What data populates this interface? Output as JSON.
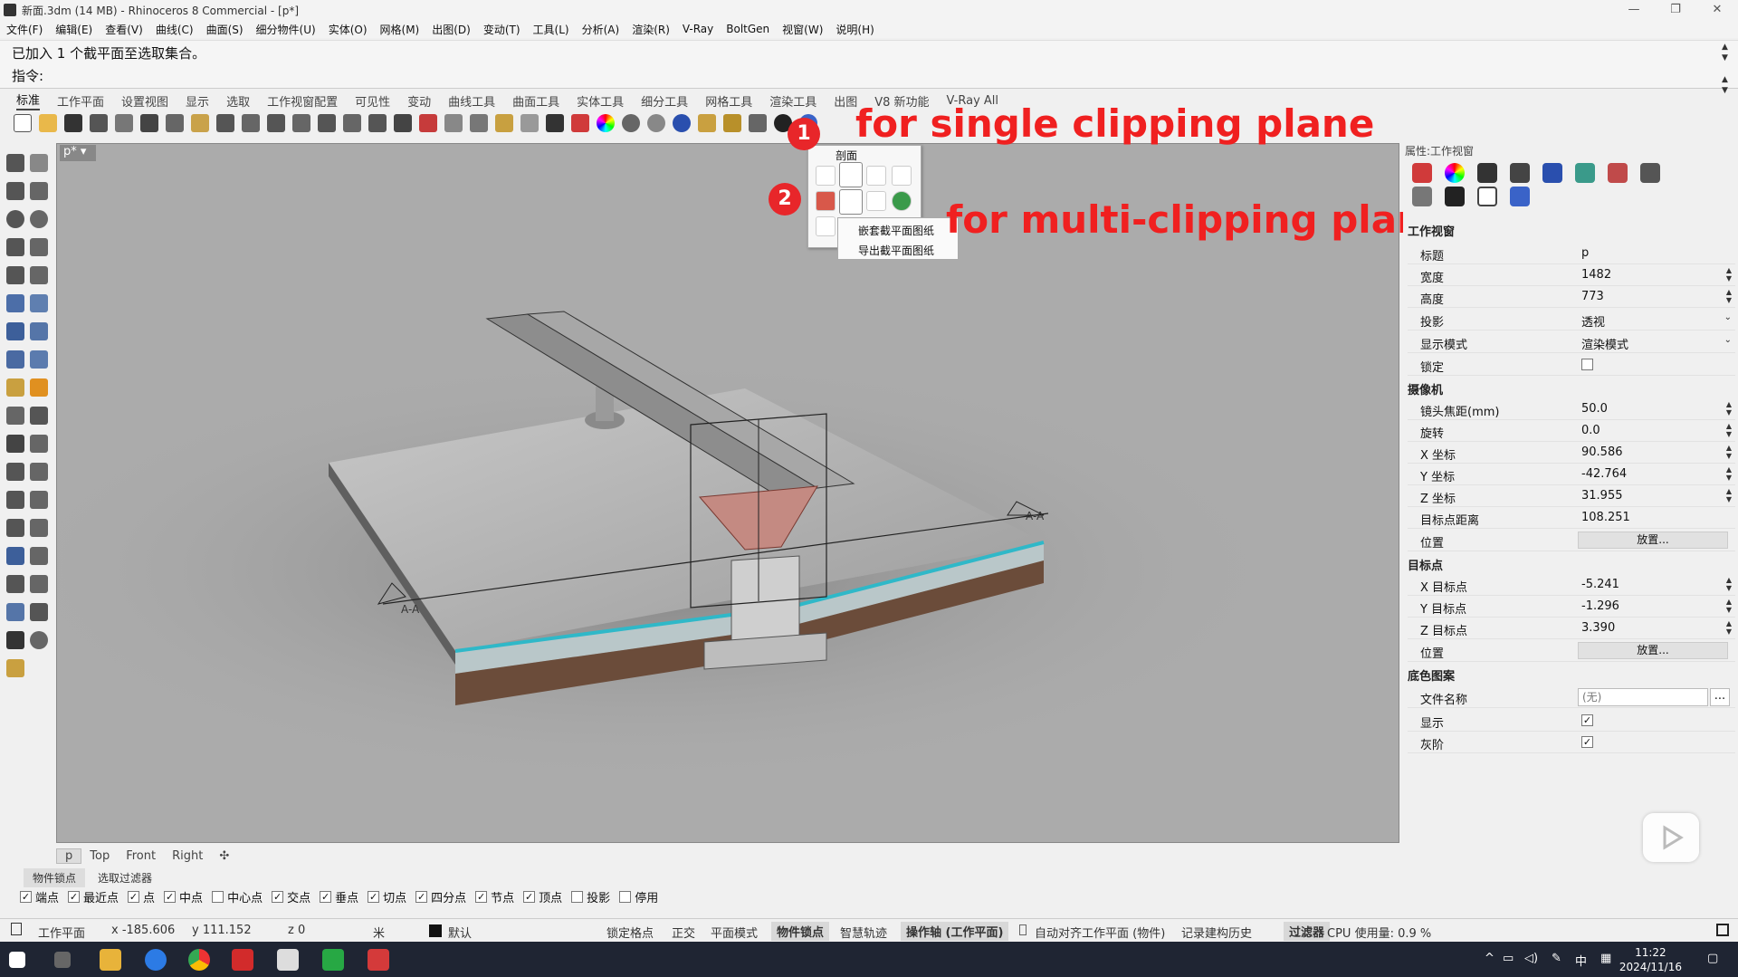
{
  "window": {
    "title": "新面.3dm (14 MB) - Rhinoceros 8 Commercial - [p*]",
    "controls": [
      "—",
      "❐",
      "✕"
    ]
  },
  "menu": [
    "文件(F)",
    "编辑(E)",
    "查看(V)",
    "曲线(C)",
    "曲面(S)",
    "细分物件(U)",
    "实体(O)",
    "网格(M)",
    "出图(D)",
    "变动(T)",
    "工具(L)",
    "分析(A)",
    "渲染(R)",
    "V-Ray",
    "BoltGen",
    "视窗(W)",
    "说明(H)"
  ],
  "command": {
    "history": "已加入 1 个截平面至选取集合。",
    "prompt": "指令:"
  },
  "toolbar_tabs": [
    "标准",
    "工作平面",
    "设置视图",
    "显示",
    "选取",
    "工作视窗配置",
    "可见性",
    "变动",
    "曲线工具",
    "曲面工具",
    "实体工具",
    "细分工具",
    "网格工具",
    "渲染工具",
    "出图",
    "V8 新功能",
    "V-Ray All"
  ],
  "viewport": {
    "tab_label": "p*",
    "section_label": "A-A"
  },
  "popup": {
    "title": "剖面",
    "submenu": [
      "嵌套截平面图纸",
      "导出截平面图纸"
    ]
  },
  "annotations": {
    "badge1": "1",
    "badge2": "2",
    "text1": "for single clipping plane",
    "text2": "for multi-clipping planes"
  },
  "properties": {
    "title": "属性:工作视窗",
    "viewport_section": "工作视窗",
    "rows_viewport": [
      {
        "label": "标题",
        "value": "p"
      },
      {
        "label": "宽度",
        "value": "1482"
      },
      {
        "label": "高度",
        "value": "773"
      },
      {
        "label": "投影",
        "value": "透视"
      },
      {
        "label": "显示模式",
        "value": "渲染模式"
      },
      {
        "label": "锁定",
        "value": ""
      }
    ],
    "camera_section": "摄像机",
    "rows_camera": [
      {
        "label": "镜头焦距(mm)",
        "value": "50.0"
      },
      {
        "label": "旋转",
        "value": "0.0"
      },
      {
        "label": "X 坐标",
        "value": "90.586"
      },
      {
        "label": "Y 坐标",
        "value": "-42.764"
      },
      {
        "label": "Z 坐标",
        "value": "31.955"
      },
      {
        "label": "目标点距离",
        "value": "108.251"
      },
      {
        "label": "位置",
        "value": "放置..."
      }
    ],
    "target_section": "目标点",
    "rows_target": [
      {
        "label": "X 目标点",
        "value": "-5.241"
      },
      {
        "label": "Y 目标点",
        "value": "-1.296"
      },
      {
        "label": "Z 目标点",
        "value": "3.390"
      },
      {
        "label": "位置",
        "value": "放置..."
      }
    ],
    "bg_section": "底色图案",
    "rows_bg": [
      {
        "label": "文件名称",
        "value": "(无)"
      },
      {
        "label": "显示",
        "value": "✓"
      },
      {
        "label": "灰阶",
        "value": "✓"
      }
    ]
  },
  "view_tabs": [
    "p",
    "Top",
    "Front",
    "Right",
    "✣"
  ],
  "osnap_tabs": [
    "物件锁点",
    "选取过滤器"
  ],
  "osnaps": [
    {
      "label": "端点",
      "checked": true
    },
    {
      "label": "最近点",
      "checked": true
    },
    {
      "label": "点",
      "checked": true
    },
    {
      "label": "中点",
      "checked": true
    },
    {
      "label": "中心点",
      "checked": false
    },
    {
      "label": "交点",
      "checked": true
    },
    {
      "label": "垂点",
      "checked": true
    },
    {
      "label": "切点",
      "checked": true
    },
    {
      "label": "四分点",
      "checked": true
    },
    {
      "label": "节点",
      "checked": true
    },
    {
      "label": "顶点",
      "checked": true
    },
    {
      "label": "投影",
      "checked": false
    },
    {
      "label": "停用",
      "checked": false
    }
  ],
  "status": {
    "cplane": "工作平面",
    "x": "x -185.606",
    "y": "y 111.152",
    "z": "z 0",
    "unit": "米",
    "layer": "默认",
    "grid_snap": "锁定格点",
    "ortho": "正交",
    "planar": "平面模式",
    "osnap": "物件锁点",
    "smart_track": "智慧轨迹",
    "gumball": "操作轴 (工作平面)",
    "auto_align": "自动对齐工作平面 (物件)",
    "history": "记录建构历史",
    "filter": "过滤器",
    "cpu": "CPU 使用量: 0.9 %"
  },
  "taskbar": {
    "time": "11:22",
    "date": "2024/11/16",
    "ime": "中"
  },
  "colors": {
    "annotation_red": "#f02020",
    "viewport_bg": "#ababab",
    "cyan_edge": "#2fb8c8"
  }
}
